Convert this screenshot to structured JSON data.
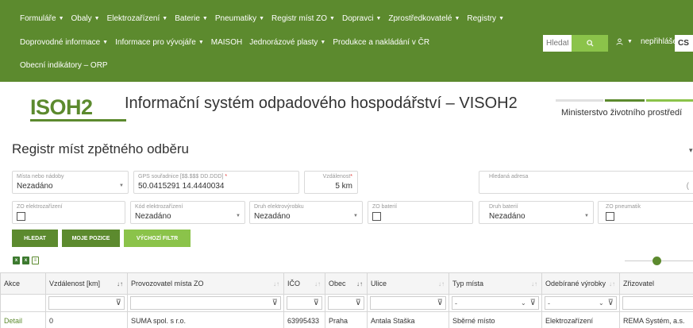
{
  "nav": {
    "row1": [
      "Formuláře",
      "Obaly",
      "Elektrozařízení",
      "Baterie",
      "Pneumatiky",
      "Registr míst ZO",
      "Dopravci",
      "Zprostředkovatelé",
      "Registry"
    ],
    "row2": [
      {
        "label": "Doprovodné informace",
        "caret": true
      },
      {
        "label": "Informace pro vývojáře",
        "caret": true
      },
      {
        "label": "MAISOH",
        "caret": false
      },
      {
        "label": "Jednorázové plasty",
        "caret": true
      },
      {
        "label": "Produkce a nakládání v ČR",
        "caret": false
      }
    ],
    "row3": [
      "Obecní indikátory – ORP"
    ],
    "search_placeholder": "Hledat",
    "user_label": "nepřihlášen",
    "language": "CS"
  },
  "header": {
    "logo": "ISOH2",
    "title": "Informační systém odpadového hospodářství – VISOH2",
    "ministry": "Ministerstvo životního prostředí"
  },
  "page": {
    "title": "Registr míst zpětného odběru"
  },
  "filters": {
    "mista": {
      "label": "Místa nebo nádoby",
      "value": "Nezadáno"
    },
    "gps": {
      "label": "GPS souřadnice [$$.$$$ DD.DDD]",
      "required": "*",
      "value": "50.0415291 14.4440034"
    },
    "vzdalenost": {
      "label": "Vzdálenost",
      "required": "*",
      "value": "5 km"
    },
    "adresa": {
      "label": "Hledaná adresa",
      "value": ""
    },
    "zo_elektro": {
      "label": "ZO elektrozařízení"
    },
    "kod_elektro": {
      "label": "Kód elektrozařízení",
      "value": "Nezadáno"
    },
    "druh_elektro": {
      "label": "Druh elektrovýrobku",
      "value": "Nezadáno"
    },
    "zo_baterii": {
      "label": "ZO baterií"
    },
    "druh_baterii": {
      "label": "Druh baterií",
      "value": "Nezadáno"
    },
    "zo_pneu": {
      "label": "ZO pneumatik"
    }
  },
  "buttons": {
    "hledat": "HLEDAT",
    "moje_pozice": "MOJE POZICE",
    "vychozi_filtr": "VÝCHOZÍ FILTR"
  },
  "table": {
    "columns": [
      "Akce",
      "Vzdálenost [km]",
      "Provozovatel místa ZO",
      "IČO",
      "Obec",
      "Ulice",
      "Typ místa",
      "Odebírané výrobky",
      "Zřizovatel"
    ],
    "filter_placeholders": {
      "typ_mista": "-",
      "odebirane": "-"
    },
    "rows": [
      [
        "Detail",
        "0",
        "SUMA spol. s r.o.",
        "63995433",
        "Praha",
        "Antala Staška",
        "Sběrné místo",
        "Elektrozařízení",
        "REMA Systém, a.s."
      ]
    ]
  },
  "colors": {
    "brand_green": "#5c8a2e",
    "accent_green": "#8bc34a"
  }
}
